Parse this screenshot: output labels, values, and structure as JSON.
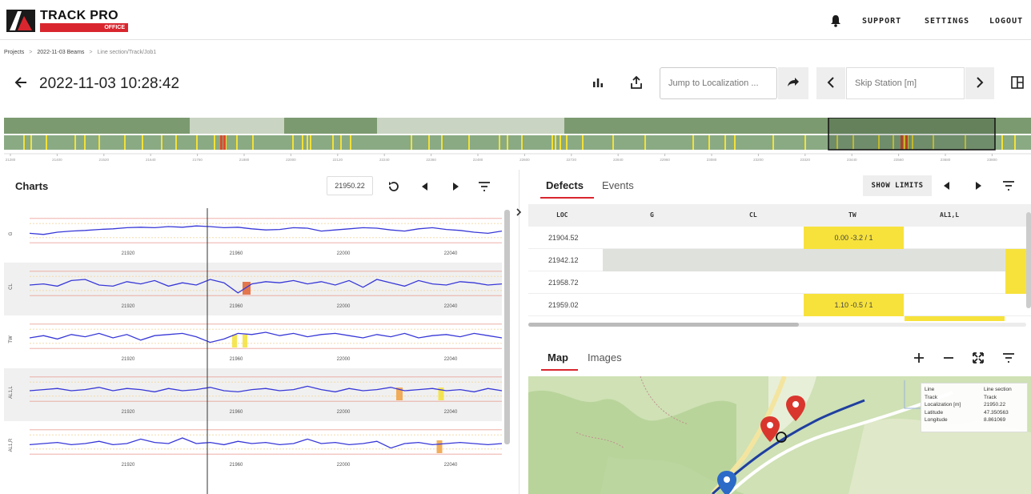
{
  "header": {
    "logo_title": "TRACK PRO",
    "logo_sub": "OFFICE",
    "nav": [
      {
        "label": "SUPPORT"
      },
      {
        "label": "SETTINGS"
      },
      {
        "label": "LOGOUT"
      }
    ]
  },
  "breadcrumb": {
    "items": [
      "Projects",
      "2022-11-03 Beams",
      "Line section/Track/Job1"
    ]
  },
  "toolbar": {
    "title": "2022-11-03 10:28:42",
    "jump_placeholder": "Jump to Localization ...",
    "skip_placeholder": "Skip Station [m]"
  },
  "overview": {
    "ticks": [
      "21280",
      "21400",
      "21520",
      "21640",
      "21760",
      "21880",
      "22000",
      "22120",
      "22240",
      "22360",
      "22480",
      "22600",
      "22720",
      "22840",
      "22960",
      "23080",
      "23200",
      "23320",
      "23440",
      "23560",
      "23680",
      "23800"
    ]
  },
  "charts_panel": {
    "title": "Charts",
    "current_loc": "21950.22",
    "channels": [
      {
        "name": "G",
        "x_ticks": [
          "21920",
          "21960",
          "22000",
          "22040"
        ]
      },
      {
        "name": "CL",
        "x_ticks": [
          "21920",
          "21960",
          "22000",
          "22040"
        ]
      },
      {
        "name": "TW",
        "x_ticks": [
          "21920",
          "21960",
          "22000",
          "22040"
        ]
      },
      {
        "name": "AL1,L",
        "x_ticks": [
          "21920",
          "21960",
          "22000",
          "22040"
        ]
      },
      {
        "name": "AL1,R",
        "x_ticks": [
          "21920",
          "21960",
          "22000",
          "22040"
        ]
      }
    ]
  },
  "defects_panel": {
    "tabs": [
      {
        "label": "Defects"
      },
      {
        "label": "Events"
      }
    ],
    "show_limits_label": "SHOW LIMITS",
    "columns": [
      "LOC",
      "G",
      "CL",
      "TW",
      "AL1,L"
    ],
    "rows": [
      {
        "loc": "21904.52",
        "tw": "0.00 -3.2 / 1"
      },
      {
        "loc": "21942.12",
        "tw": ""
      },
      {
        "loc": "21958.72",
        "tw": ""
      },
      {
        "loc": "21959.02",
        "tw": "1.10 -0.5 / 1"
      }
    ],
    "colors": {
      "yellow": "#f7e23c",
      "grey": "#dfe1dd"
    }
  },
  "map_panel": {
    "tabs": [
      {
        "label": "Map"
      },
      {
        "label": "Images"
      }
    ],
    "info": [
      {
        "key": "Line",
        "value": "Line section"
      },
      {
        "key": "Track",
        "value": "Track"
      },
      {
        "key": "Localization [m]",
        "value": "21950.22"
      },
      {
        "key": "Latitude",
        "value": "47.350563"
      },
      {
        "key": "Longitude",
        "value": "8.861069"
      }
    ]
  },
  "colors": {
    "accent": "#d9262e",
    "series": "#3838d8",
    "overview_dark": "#7c9a70",
    "overview_light": "#c9d4c2",
    "map_green": "#cfe1b5"
  }
}
